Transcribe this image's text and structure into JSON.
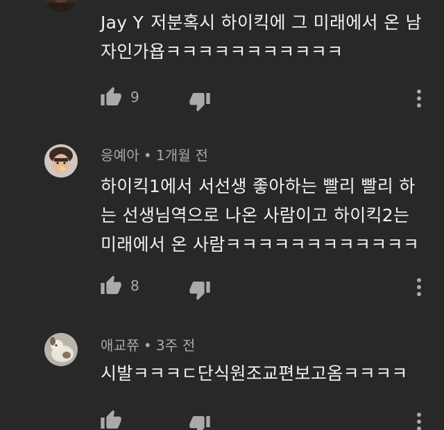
{
  "comments": [
    {
      "mention": "Jay Y",
      "text": "저분혹시 하이킥에 그 미래에서 온 남자인가욥ㅋㅋㅋㅋㅋㅋㅋㅋㅋㅋㅋ",
      "likes": "9"
    },
    {
      "author": "응예아",
      "separator": "•",
      "time": "1개월 전",
      "text": "하이킥1에서 서선생 좋아하는 빨리 빨리 하는 선생님역으로 나온 사람이고 하이킥2는 미래에서 온 사람ㅋㅋㅋㅋㅋㅋㅋㅋㅋㅋㅋㅋ",
      "likes": "8"
    },
    {
      "author": "애교쮸",
      "separator": "•",
      "time": "3주 전",
      "text": "시발ㅋㅋㅋㄷ단식원조교편보고옴ㅋㅋㅋㅋ",
      "likes": ""
    }
  ],
  "icons": {
    "like": "thumbs-up-icon",
    "dislike": "thumbs-down-icon",
    "more": "more-vertical-icon"
  },
  "colors": {
    "background": "#282828",
    "primary_text": "#f1f1f1",
    "secondary_text": "#aaaaaa"
  }
}
